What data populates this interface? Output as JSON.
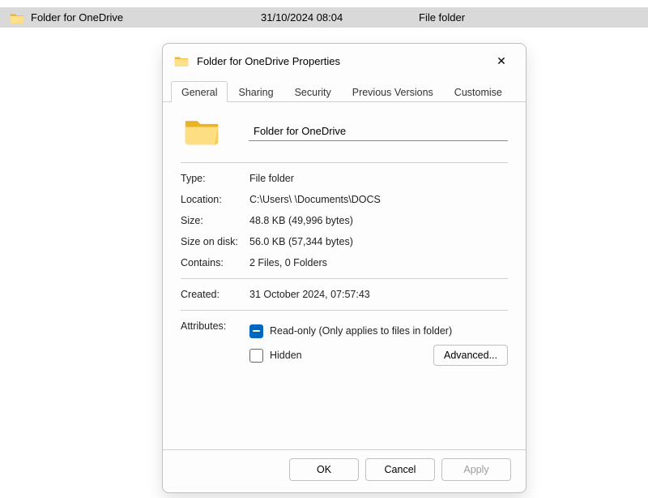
{
  "explorer_row": {
    "name": "Folder for OneDrive",
    "date": "31/10/2024 08:04",
    "type": "File folder"
  },
  "dialog": {
    "title": "Folder for OneDrive Properties",
    "tabs": [
      "General",
      "Sharing",
      "Security",
      "Previous Versions",
      "Customise"
    ],
    "active_tab": 0,
    "name_value": "Folder for OneDrive",
    "labels": {
      "type": "Type:",
      "location": "Location:",
      "size": "Size:",
      "size_on_disk": "Size on disk:",
      "contains": "Contains:",
      "created": "Created:",
      "attributes": "Attributes:"
    },
    "values": {
      "type": "File folder",
      "location": "C:\\Users\\        \\Documents\\DOCS",
      "size": "48.8 KB (49,996 bytes)",
      "size_on_disk": "56.0 KB (57,344 bytes)",
      "contains": "2 Files, 0 Folders",
      "created": "31 October 2024, 07:57:43"
    },
    "attributes": {
      "readonly_label": "Read-only (Only applies to files in folder)",
      "readonly_state": "indeterminate",
      "hidden_label": "Hidden",
      "hidden_state": "unchecked",
      "advanced_label": "Advanced..."
    },
    "buttons": {
      "ok": "OK",
      "cancel": "Cancel",
      "apply": "Apply"
    }
  }
}
